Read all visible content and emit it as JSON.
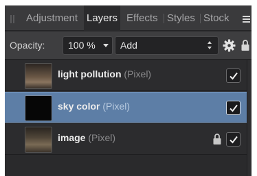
{
  "tabs": [
    {
      "label": "Adjustment",
      "active": false
    },
    {
      "label": "Layers",
      "active": true
    },
    {
      "label": "Effects",
      "active": false
    },
    {
      "label": "Styles",
      "active": false
    },
    {
      "label": "Stock",
      "active": false
    }
  ],
  "toolbar": {
    "opacity_label": "Opacity:",
    "opacity_value": "100 %",
    "blend_mode": "Add",
    "settings_icon": "gear-icon",
    "lock_icon": "lock-icon"
  },
  "layers": [
    {
      "name": "light pollution",
      "type": "(Pixel)",
      "selected": false,
      "locked": false,
      "visible": true,
      "thumb_color": "#5a4a3a"
    },
    {
      "name": "sky color",
      "type": "(Pixel)",
      "selected": true,
      "locked": false,
      "visible": true,
      "thumb_color": "#050505"
    },
    {
      "name": "image",
      "type": "(Pixel)",
      "selected": false,
      "locked": true,
      "visible": true,
      "thumb_color": "#4d4436"
    }
  ],
  "colors": {
    "panel_bg": "#2a2a2c",
    "selection": "#5d7ea6",
    "text": "#ececec",
    "muted_text": "#8a8a8c"
  }
}
